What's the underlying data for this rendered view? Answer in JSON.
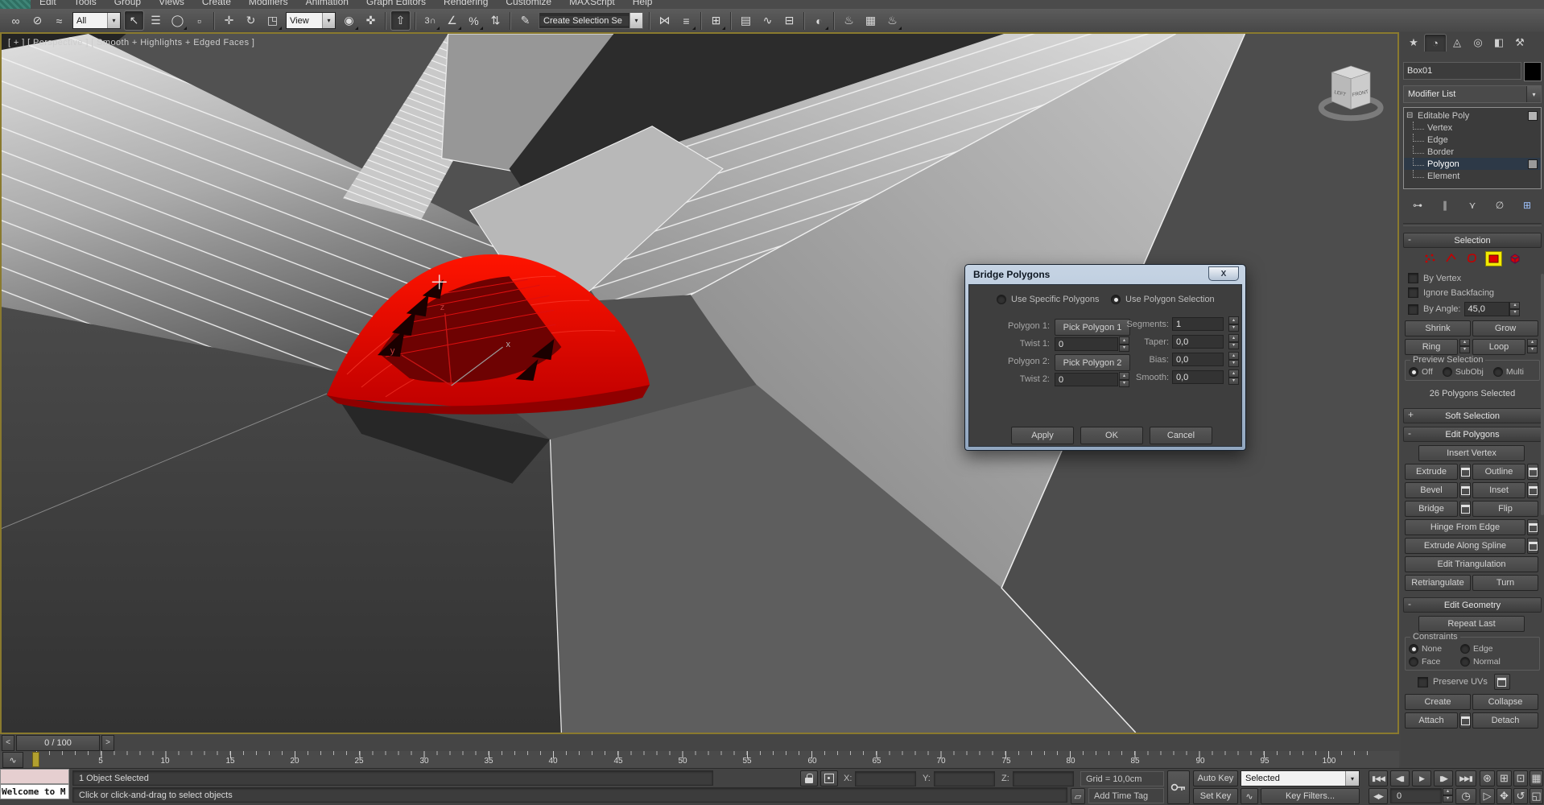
{
  "ui": {
    "combo_arrow": "▾",
    "spin_up": "▴",
    "spin_down": "▾",
    "minus": "-",
    "plus": "+",
    "stack_minus": "⊟",
    "close_x": "X"
  },
  "menu": {
    "items": [
      "Edit",
      "Tools",
      "Group",
      "Views",
      "Create",
      "Modifiers",
      "Animation",
      "Graph Editors",
      "Rendering",
      "Customize",
      "MAXScript",
      "Help"
    ]
  },
  "toolbar": {
    "filter_combo": "All",
    "coord_combo": "View",
    "sets_combo": "Create Selection Se",
    "icons": [
      {
        "name": "select-and-link",
        "glyph": "∞"
      },
      {
        "name": "unlink-selection",
        "glyph": "⊘"
      },
      {
        "name": "bind-to-space-warp",
        "glyph": "≈"
      },
      {
        "name": "select-object",
        "glyph": "↖"
      },
      {
        "name": "select-by-name",
        "glyph": "☰"
      },
      {
        "name": "selection-region-circle",
        "glyph": "◯"
      },
      {
        "name": "window-crossing-toggle",
        "glyph": "▫"
      },
      {
        "name": "select-and-move",
        "glyph": "✛"
      },
      {
        "name": "select-and-rotate",
        "glyph": "↻"
      },
      {
        "name": "select-and-scale",
        "glyph": "◳"
      },
      {
        "name": "use-pivot-point-center",
        "glyph": "◉"
      },
      {
        "name": "select-and-manipulate",
        "glyph": "✜"
      },
      {
        "name": "keyboard-shortcut-override",
        "glyph": "⇧"
      },
      {
        "name": "snaps-toggle-3d",
        "glyph": "3∩"
      },
      {
        "name": "angle-snap-toggle",
        "glyph": "∠"
      },
      {
        "name": "percent-snap-toggle",
        "glyph": "%"
      },
      {
        "name": "spinner-snap-toggle",
        "glyph": "⇅"
      },
      {
        "name": "edit-named-selection-sets",
        "glyph": "✎"
      },
      {
        "name": "mirror",
        "glyph": "⋈"
      },
      {
        "name": "align",
        "glyph": "≡"
      },
      {
        "name": "manage-layers",
        "glyph": "⊞"
      },
      {
        "name": "toggle-container",
        "glyph": "▤"
      },
      {
        "name": "curve-editor",
        "glyph": "∿"
      },
      {
        "name": "schematic-view",
        "glyph": "⊟"
      },
      {
        "name": "material-editor",
        "glyph": "◐"
      },
      {
        "name": "render-setup",
        "glyph": "♨"
      },
      {
        "name": "rendered-frame-window",
        "glyph": "▦"
      },
      {
        "name": "render-production",
        "glyph": "♨"
      }
    ]
  },
  "viewport": {
    "label": "[ + ] [ Perspective ] [ Smooth + Highlights + Edged Faces ]",
    "axis": {
      "x": "x",
      "y": "y",
      "z": "z"
    },
    "viewcube": {
      "left": "LEFT",
      "front": "FRONT"
    }
  },
  "dialog": {
    "title": "Bridge Polygons",
    "option1": "Use Specific Polygons",
    "option2": "Use Polygon Selection",
    "rows_left": [
      {
        "label": "Polygon 1:",
        "value": "Pick Polygon 1"
      },
      {
        "label": "Twist 1:",
        "value": "0"
      },
      {
        "label": "Polygon 2:",
        "value": "Pick Polygon 2"
      },
      {
        "label": "Twist 2:",
        "value": "0"
      }
    ],
    "rows_right": [
      {
        "label": "Segments:",
        "value": "1"
      },
      {
        "label": "Taper:",
        "value": "0,0"
      },
      {
        "label": "Bias:",
        "value": "0,0"
      },
      {
        "label": "Smooth:",
        "value": "0,0"
      }
    ],
    "apply": "Apply",
    "ok": "OK",
    "cancel": "Cancel"
  },
  "panel": {
    "tabs": [
      {
        "name": "create",
        "glyph": "★"
      },
      {
        "name": "modify",
        "glyph": "◔"
      },
      {
        "name": "hierarchy",
        "glyph": "◬"
      },
      {
        "name": "motion",
        "glyph": "◎"
      },
      {
        "name": "display",
        "glyph": "◧"
      },
      {
        "name": "utilities",
        "glyph": "⚒"
      }
    ],
    "object_name": "Box01",
    "modifier_list": "Modifier List",
    "stack": [
      "Editable Poly",
      "Vertex",
      "Edge",
      "Border",
      "Polygon",
      "Element"
    ],
    "stack_tools": [
      {
        "name": "pin-stack",
        "glyph": "⊶"
      },
      {
        "name": "show-end-result",
        "glyph": "∥"
      },
      {
        "name": "make-unique",
        "glyph": "⋎"
      },
      {
        "name": "remove-modifier",
        "glyph": "∅"
      },
      {
        "name": "configure-modifier-sets",
        "glyph": "⊞"
      }
    ],
    "selection": {
      "title": "Selection",
      "by_vertex": "By Vertex",
      "ignore_backfacing": "Ignore Backfacing",
      "by_angle": "By Angle:",
      "by_angle_value": "45,0",
      "shrink": "Shrink",
      "grow": "Grow",
      "ring": "Ring",
      "loop": "Loop",
      "preview_title": "Preview Selection",
      "off": "Off",
      "subobj": "SubObj",
      "multi": "Multi",
      "status": "26 Polygons Selected"
    },
    "soft_selection_title": "Soft Selection",
    "edit_polygons": {
      "title": "Edit Polygons",
      "insert_vertex": "Insert Vertex",
      "extrude": "Extrude",
      "outline": "Outline",
      "bevel": "Bevel",
      "inset": "Inset",
      "bridge": "Bridge",
      "flip": "Flip",
      "hinge": "Hinge From Edge",
      "extrude_spline": "Extrude Along Spline",
      "edit_tri": "Edit Triangulation",
      "retriangulate": "Retriangulate",
      "turn": "Turn"
    },
    "edit_geometry": {
      "title": "Edit Geometry",
      "repeat_last": "Repeat Last",
      "constraints": "Constraints",
      "none": "None",
      "edge": "Edge",
      "face": "Face",
      "normal": "Normal",
      "preserve_uvs": "Preserve UVs",
      "create": "Create",
      "collapse": "Collapse",
      "attach": "Attach",
      "detach": "Detach"
    }
  },
  "timeline": {
    "prev": "<",
    "next": ">",
    "value": "0 / 100",
    "ticks": [
      0,
      5,
      10,
      15,
      20,
      25,
      30,
      35,
      40,
      45,
      50,
      55,
      60,
      65,
      70,
      75,
      80,
      85,
      90,
      95,
      100
    ],
    "mini_curve_editor_glyph": "∿"
  },
  "statusbar": {
    "listener_text": "Welcome to M",
    "status": "1 Object Selected",
    "prompt": "Click or click-and-drag to select objects",
    "x": "X:",
    "y": "Y:",
    "z": "Z:",
    "grid": "Grid = 10,0cm",
    "tag_glyph": "▱",
    "add_time_tag": "Add Time Tag",
    "auto_key": "Auto Key",
    "set_key": "Set Key",
    "selected": "Selected",
    "key_filters": "Key Filters...",
    "frame": "0",
    "key_mode_glyph": "◀▶",
    "curve_glyph": "∿",
    "transport": [
      {
        "name": "go-to-start",
        "glyph": "▮◀◀"
      },
      {
        "name": "previous-frame",
        "glyph": "◀▮"
      },
      {
        "name": "play",
        "glyph": "▶"
      },
      {
        "name": "next-frame",
        "glyph": "▮▶"
      },
      {
        "name": "go-to-end",
        "glyph": "▶▶▮"
      }
    ],
    "nav": [
      {
        "name": "zoom",
        "glyph": "⊛"
      },
      {
        "name": "zoom-all",
        "glyph": "⊞"
      },
      {
        "name": "zoom-extents",
        "glyph": "⊡"
      },
      {
        "name": "zoom-extents-all",
        "glyph": "▦"
      },
      {
        "name": "time-configuration",
        "glyph": "◷"
      },
      {
        "name": "walk-through",
        "glyph": "▷"
      },
      {
        "name": "pan-view",
        "glyph": "✥"
      },
      {
        "name": "orbit",
        "glyph": "↺"
      },
      {
        "name": "maximize-viewport-toggle",
        "glyph": "◱"
      }
    ]
  }
}
